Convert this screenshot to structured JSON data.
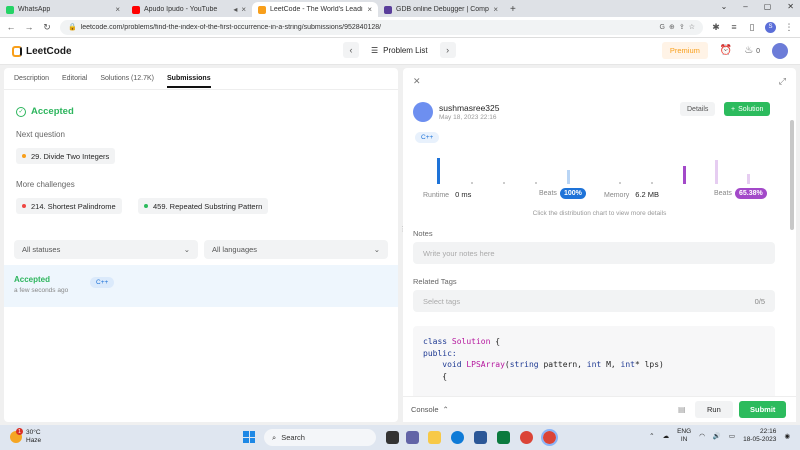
{
  "browser": {
    "tabs": [
      {
        "title": "WhatsApp",
        "color": "#25d366",
        "active": false
      },
      {
        "title": "Apudo Ipudo - YouTube",
        "color": "#ff0000",
        "active": false
      },
      {
        "title": "LeetCode - The World's Leading",
        "color": "#f89f1b",
        "active": true
      },
      {
        "title": "GDB online Debugger | Compiler",
        "color": "#5a3e9b",
        "active": false
      }
    ],
    "new_tab": "+",
    "url": "leetcode.com/problems/find-the-index-of-the-first-occurrence-in-a-string/submissions/952840128/"
  },
  "header": {
    "logo_text": "LeetCode",
    "problem_list": "Problem List",
    "premium": "Premium",
    "streak_count": "0"
  },
  "left": {
    "tabs": [
      "Description",
      "Editorial",
      "Solutions (12.7K)",
      "Submissions"
    ],
    "active_tab": "Submissions",
    "status": "Accepted",
    "next_question_label": "Next question",
    "next_question": {
      "title": "29. Divide Two Integers",
      "dot_color": "#f89f1b"
    },
    "more_challenges_label": "More challenges",
    "challenges": [
      {
        "title": "214. Shortest Palindrome",
        "dot_color": "#ef4743"
      },
      {
        "title": "459. Repeated Substring Pattern",
        "dot_color": "#2cbb5d"
      }
    ],
    "filter_status": "All statuses",
    "filter_language": "All languages",
    "submission": {
      "status": "Accepted",
      "time": "a few seconds ago",
      "lang": "C++"
    }
  },
  "right": {
    "username": "sushmasree325",
    "date": "May 18, 2023 22:16",
    "details_label": "Details",
    "solution_label": "Solution",
    "language": "C++",
    "runtime_label": "Runtime",
    "runtime_value": "0 ms",
    "runtime_beats_label": "Beats",
    "runtime_beats": "100%",
    "memory_label": "Memory",
    "memory_value": "6.2 MB",
    "memory_beats_label": "Beats",
    "memory_beats": "65.38%",
    "dist_hint": "Click the distribution chart to view more details",
    "notes_label": "Notes",
    "notes_placeholder": "Write your notes here",
    "tags_label": "Related Tags",
    "tags_placeholder": "Select tags",
    "tags_count": "0/5",
    "code_lines": [
      "class Solution {",
      "public:",
      "    void LPSArray(string pattern, int M, int* lps)",
      "    {"
    ],
    "colors": {
      "accent_green": "#2cbb5d",
      "runtime_blue": "#1e73d8",
      "memory_purple": "#a349c9"
    }
  },
  "console": {
    "label": "Console",
    "run": "Run",
    "submit": "Submit"
  },
  "taskbar": {
    "temp": "30°C",
    "weather": "Haze",
    "weather_badge": "1",
    "search": "Search",
    "lang": "ENG",
    "region": "IN",
    "time": "22:16",
    "date": "18-05-2023"
  }
}
